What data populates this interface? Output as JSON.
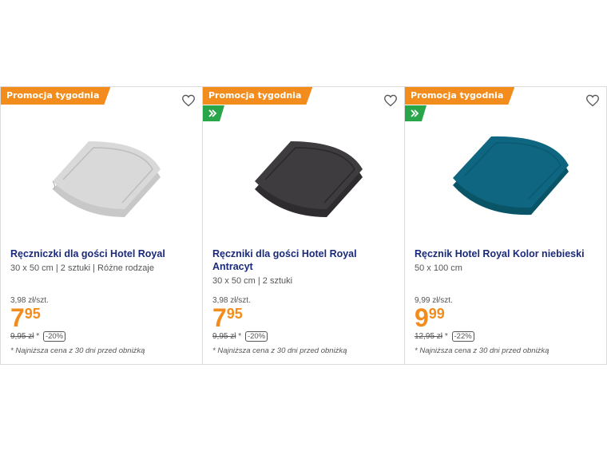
{
  "products": [
    {
      "badge": "Promocja tygodnia",
      "has_green_tag": false,
      "title": "Ręczniczki dla gości Hotel Royal",
      "subtitle": "30 x 50 cm | 2 sztuki | Różne rodzaje",
      "unit_price": "3,98 zł/szt.",
      "price_main": "7",
      "price_cents": "95",
      "old_price": "9,95 zł",
      "old_price_suffix": "*",
      "discount": "-20%",
      "note": "* Najniższa cena z 30 dni przed obniżką",
      "towel_color": "#d9d9d9"
    },
    {
      "badge": "Promocja tygodnia",
      "has_green_tag": true,
      "title": "Ręczniki dla gości Hotel Royal Antracyt",
      "subtitle": "30 x 50 cm | 2 sztuki",
      "unit_price": "3,98 zł/szt.",
      "price_main": "7",
      "price_cents": "95",
      "old_price": "9,95 zł",
      "old_price_suffix": "*",
      "discount": "-20%",
      "note": "* Najniższa cena z 30 dni przed obniżką",
      "towel_color": "#3e3c3f"
    },
    {
      "badge": "Promocja tygodnia",
      "has_green_tag": true,
      "title": "Ręcznik Hotel Royal Kolor niebieski",
      "subtitle": "50 x 100 cm",
      "unit_price": "9,99 zł/szt.",
      "price_main": "9",
      "price_cents": "99",
      "old_price": "12,95 zł",
      "old_price_suffix": "*",
      "discount": "-22%",
      "note": "* Najniższa cena z 30 dni przed obniżką",
      "towel_color": "#0e6680"
    }
  ],
  "icons": {
    "favorite": "heart-outline-icon",
    "green_tag": "double-chevron-icon"
  },
  "colors": {
    "promo": "#f28c1c",
    "green": "#2aa64a",
    "title": "#1a2a7a"
  }
}
